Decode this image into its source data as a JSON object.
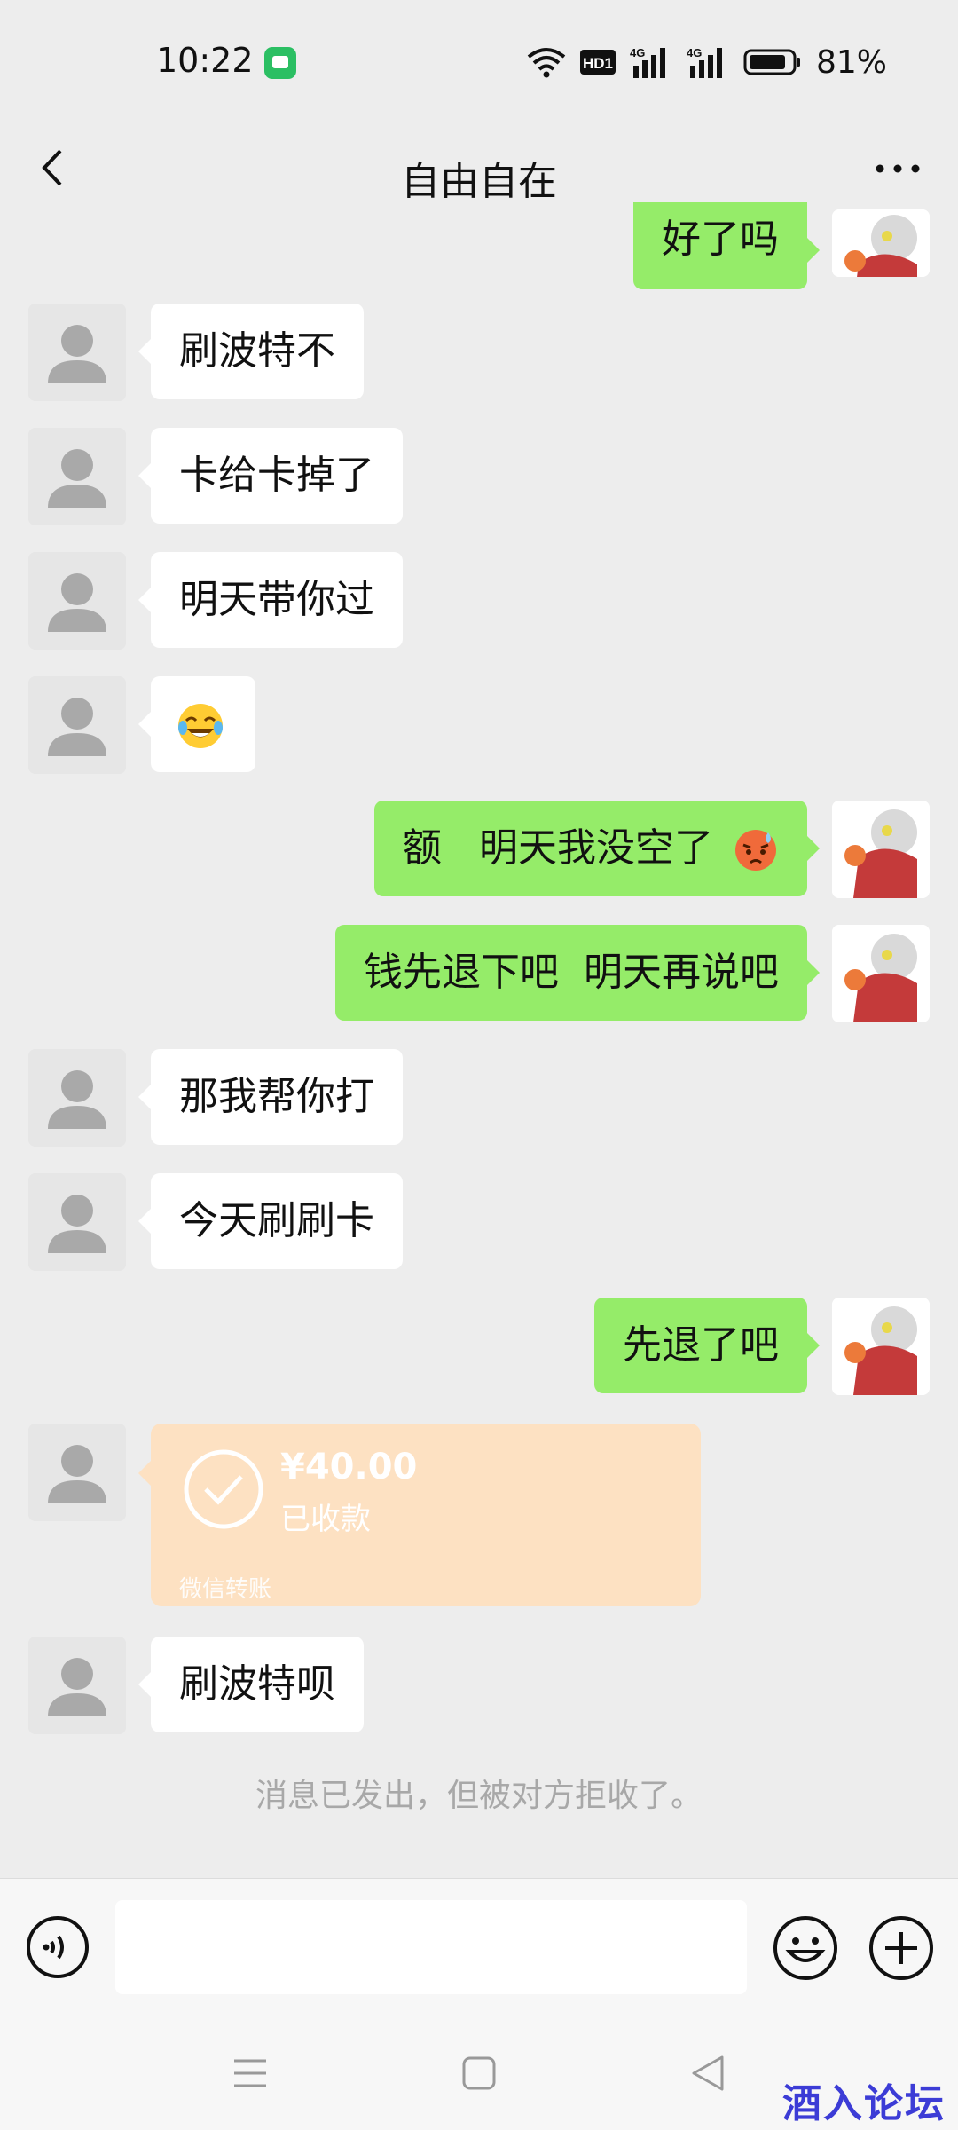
{
  "status_bar": {
    "time": "10:22",
    "network_badge": "HD1",
    "signal_1": "4G",
    "signal_2": "4G",
    "battery": "81%"
  },
  "header": {
    "title": "自由自在"
  },
  "messages": [
    {
      "side": "out",
      "text": "好了吗"
    },
    {
      "side": "in",
      "text": "刷波特不"
    },
    {
      "side": "in",
      "text": "卡给卡掉了"
    },
    {
      "side": "in",
      "text": "明天带你过"
    },
    {
      "side": "in",
      "text": "",
      "emoji": "tears-of-joy-emoji"
    },
    {
      "side": "out",
      "text": "额   明天我没空了",
      "emoji": "sweat-emoji"
    },
    {
      "side": "out",
      "text": "钱先退下吧  明天再说吧"
    },
    {
      "side": "in",
      "text": "那我帮你打"
    },
    {
      "side": "in",
      "text": "今天刷刷卡"
    },
    {
      "side": "out",
      "text": "先退了吧"
    },
    {
      "side": "in",
      "type": "transfer",
      "amount": "¥40.00",
      "status": "已收款",
      "footer": "微信转账"
    },
    {
      "side": "in",
      "text": "刷波特呗"
    }
  ],
  "system_notice": "消息已发出，但被对方拒收了。",
  "input_bar": {
    "placeholder": ""
  },
  "watermark": "酒入论坛",
  "colors": {
    "background": "#ededed",
    "outgoing_bubble": "#95ec69",
    "incoming_bubble": "#ffffff",
    "transfer_card": "#fde1c2",
    "notice_text": "#a8a8a8"
  }
}
